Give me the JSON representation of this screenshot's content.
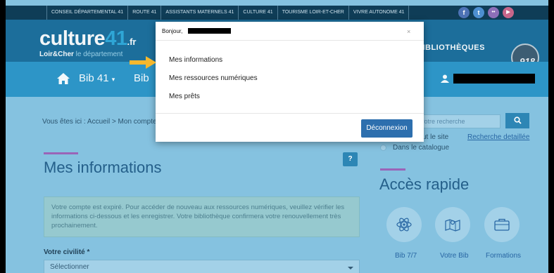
{
  "topbar": {
    "links": [
      "CONSEIL DÉPARTEMENTAL 41",
      "ROUTE 41",
      "ASSISTANTS MATERNELS 41",
      "CULTURE 41",
      "TOURISME LOIR-ET-CHER",
      "VIVRE AUTONOME 41"
    ],
    "social": [
      {
        "glyph": "f",
        "icon": "facebook-icon",
        "color": "#4d72b5"
      },
      {
        "glyph": "t",
        "icon": "twitter-icon",
        "color": "#4d8fd1"
      },
      {
        "glyph": "••",
        "icon": "flickr-icon",
        "color": "#8d6fb8"
      },
      {
        "glyph": "▶",
        "icon": "youtube-icon",
        "color": "#c7668a"
      }
    ]
  },
  "header": {
    "logo_word": "culture",
    "logo_number": "41",
    "logo_suffix": ".fr",
    "logo_sub_bold": "Loir&Cher",
    "logo_sub_rest": " le département",
    "biblio_text": "BIBLIOTHÈQUES",
    "badge_text": "918"
  },
  "nav": {
    "items": [
      "Bib 41",
      "Bib"
    ]
  },
  "breadcrumb": "Vous êtes ici : Accueil > Mon compte",
  "search": {
    "placeholder": "votre recherche",
    "option_site": "ut le site",
    "option_catalogue": "Dans le catalogue",
    "advanced_link": "Recherche detaillée"
  },
  "main": {
    "title": "Mes informations",
    "notice": "Votre compte est expiré. Pour accéder de nouveau aux ressources numériques, veuillez vérifier les informations ci-dessous et les enregistrer. Votre bibliothèque confirmera votre renouvellement très prochainement.",
    "civility_label": "Votre civilité *",
    "civility_value": "Sélectionner"
  },
  "quick_access": {
    "title": "Accès rapide",
    "items": [
      {
        "label": "Bib 7/7",
        "icon": "atom-icon"
      },
      {
        "label": "Votre Bib",
        "icon": "map-icon"
      },
      {
        "label": "Formations",
        "icon": "briefcase-icon"
      }
    ]
  },
  "modal": {
    "greeting": "Bonjour,",
    "close": "×",
    "links": [
      "Mes informations",
      "Mes ressources numériques",
      "Mes prêts"
    ],
    "logout": "Déconnexion"
  },
  "colors": {
    "overlay_bg": "#85c2e0",
    "topbar": "#0f3d57",
    "header": "#1c6e9b",
    "nav": "#2d95c7",
    "accent_rule": "#9a64b8",
    "button": "#2d6fae",
    "arrow": "#f5b82e"
  }
}
